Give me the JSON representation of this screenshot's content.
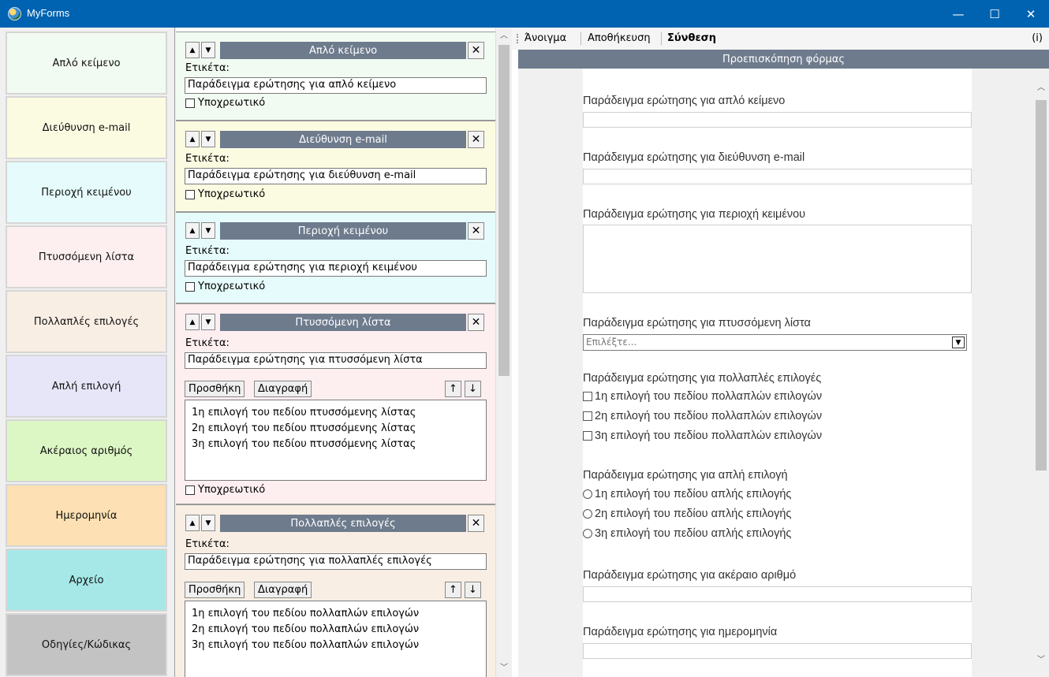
{
  "window": {
    "title": "MyForms",
    "minimize": "—",
    "maximize": "☐",
    "close": "✕"
  },
  "palette": [
    {
      "label": "Απλό κείμενο",
      "color": "#f2fbf1"
    },
    {
      "label": "Διεύθυνση e-mail",
      "color": "#fbfbe2"
    },
    {
      "label": "Περιοχή κειμένου",
      "color": "#e6fbfb"
    },
    {
      "label": "Πτυσσόμενη λίστα",
      "color": "#fdeef0"
    },
    {
      "label": "Πολλαπλές επιλογές",
      "color": "#f9eee4"
    },
    {
      "label": "Απλή επιλογή",
      "color": "#e6e6f8"
    },
    {
      "label": "Ακέραιος αριθμός",
      "color": "#dcf7c4"
    },
    {
      "label": "Ημερομηνία",
      "color": "#fde0b3"
    },
    {
      "label": "Αρχείο",
      "color": "#a6e8e8"
    },
    {
      "label": "Οδηγίες/Κώδικας",
      "color": "#c3c3c3"
    }
  ],
  "editor": {
    "label_caption": "Ετικέτα:",
    "required_caption": "Υποχρεωτικό",
    "add_label": "Προσθήκη",
    "delete_label": "Διαγραφή",
    "up_glyph": "▲",
    "down_glyph": "▼",
    "close_glyph": "✕",
    "move_up_glyph": "↑",
    "move_down_glyph": "↓",
    "blocks": [
      {
        "title": "Απλό κείμενο",
        "value": "Παράδειγμα ερώτησης για απλό κείμενο",
        "color": "#f2fbf1"
      },
      {
        "title": "Διεύθυνση e-mail",
        "value": "Παράδειγμα ερώτησης για διεύθυνση e-mail",
        "color": "#fbfbe2"
      },
      {
        "title": "Περιοχή κειμένου",
        "value": "Παράδειγμα ερώτησης για περιοχή κειμένου",
        "color": "#e6fbfb"
      },
      {
        "title": "Πτυσσόμενη λίστα",
        "value": "Παράδειγμα ερώτησης για πτυσσόμενη λίστα",
        "color": "#fdeef0",
        "options": [
          "1η επιλογή του πεδίου πτυσσόμενης λίστας",
          "2η επιλογή του πεδίου πτυσσόμενης λίστας",
          "3η επιλογή του πεδίου πτυσσόμενης λίστας"
        ]
      },
      {
        "title": "Πολλαπλές επιλογές",
        "value": "Παράδειγμα ερώτησης για πολλαπλές επιλογές",
        "color": "#f9eee4",
        "options": [
          "1η επιλογή του πεδίου πολλαπλών επιλογών",
          "2η επιλογή του πεδίου πολλαπλών επιλογών",
          "3η επιλογή του πεδίου πολλαπλών επιλογών"
        ]
      }
    ]
  },
  "menu": {
    "open": "Άνοιγμα",
    "save": "Αποθήκευση",
    "compose": "Σύνθεση",
    "info": "(i)"
  },
  "preview": {
    "header": "Προεπισκόπηση φόρμας",
    "q_text": "Παράδειγμα ερώτησης για απλό κείμενο",
    "q_email": "Παράδειγμα ερώτησης για διεύθυνση e-mail",
    "q_area": "Παράδειγμα ερώτησης για περιοχή κειμένου",
    "q_select": "Παράδειγμα ερώτησης για πτυσσόμενη λίστα",
    "select_placeholder": "Επιλέξτε...",
    "q_multi": "Παράδειγμα ερώτησης για πολλαπλές επιλογές",
    "multi_options": [
      "1η επιλογή του πεδίου πολλαπλών επιλογών",
      "2η επιλογή του πεδίου πολλαπλών επιλογών",
      "3η επιλογή του πεδίου πολλαπλών επιλογών"
    ],
    "q_single": "Παράδειγμα ερώτησης για απλή επιλογή",
    "single_options": [
      "1η επιλογή του πεδίου απλής επιλογής",
      "2η επιλογή του πεδίου απλής επιλογής",
      "3η επιλογή του πεδίου απλής επιλογής"
    ],
    "q_int": "Παράδειγμα ερώτησης για ακέραιο αριθμό",
    "q_date": "Παράδειγμα ερώτησης για ημερομηνία"
  }
}
